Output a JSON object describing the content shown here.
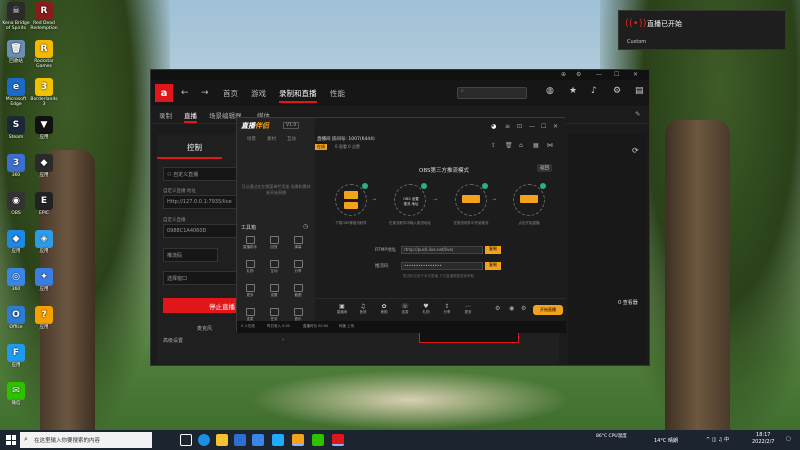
{
  "desktop": {
    "icons_col1": [
      {
        "label": "Kena Bridge of Spirits",
        "color": "#2b2b2b",
        "glyph": "☠"
      },
      {
        "label": "回收站",
        "color": "#6b8fb3",
        "glyph": "🗑"
      },
      {
        "label": "Microsoft Edge",
        "color": "#1b6ac9",
        "glyph": "e"
      },
      {
        "label": "Steam",
        "color": "#1b2838",
        "glyph": "S"
      },
      {
        "label": "360",
        "color": "#3b6fd0",
        "glyph": "3"
      },
      {
        "label": "OBS",
        "color": "#333",
        "glyph": "◉"
      },
      {
        "label": "应用",
        "color": "#1e88e5",
        "glyph": "◆"
      },
      {
        "label": "360",
        "color": "#3a86e8",
        "glyph": "◎"
      },
      {
        "label": "Office",
        "color": "#2c7cd6",
        "glyph": "O"
      },
      {
        "label": "应用",
        "color": "#1d9bf0",
        "glyph": "F"
      },
      {
        "label": "微信",
        "color": "#2dc100",
        "glyph": "✉"
      }
    ],
    "icons_col2": [
      {
        "label": "Red Dead Redemption",
        "color": "#8b1c1c",
        "glyph": "R"
      },
      {
        "label": "Rockstar Games",
        "color": "#f5b800",
        "glyph": "R"
      },
      {
        "label": "Borderlands 3",
        "color": "#f2c200",
        "glyph": "3"
      },
      {
        "label": "应用",
        "color": "#111",
        "glyph": "▼"
      },
      {
        "label": "应用",
        "color": "#2a2a2a",
        "glyph": "◆"
      },
      {
        "label": "EPIC",
        "color": "#222",
        "glyph": "E"
      },
      {
        "label": "应用",
        "color": "#2e9be8",
        "glyph": "◈"
      },
      {
        "label": "应用",
        "color": "#3b7de0",
        "glyph": "✦"
      },
      {
        "label": "应用",
        "color": "#f5a000",
        "glyph": "?"
      }
    ]
  },
  "notification": {
    "title": "直播已开始",
    "subtitle": "Custom"
  },
  "amd_window": {
    "logo": "a",
    "nav": {
      "items": [
        "首页",
        "游戏",
        "录制和直播",
        "性能"
      ],
      "active": "录制和直播"
    },
    "subtabs": [
      "录制",
      "直播",
      "场景编辑器",
      "媒体"
    ],
    "active_subtab": "直播",
    "left_panel": {
      "header": "控制",
      "platform": "自定义直播",
      "url_label": "自定义直播 地址",
      "url_value": "Http://127.0.0.1:7935/live",
      "key_label": "自定义直播",
      "key_value": "0988C1A4060D",
      "field3": "推流码",
      "field4": "选择窗口",
      "stop_label": "停止直播",
      "footer1": "麦克风",
      "footer2": "高级设置"
    },
    "preview_text": "WWAVU",
    "viewers": "0 查看器"
  },
  "overlay_app": {
    "brand_a": "直播",
    "brand_b": "伴侣",
    "version": "V1.0",
    "tabs": [
      "场景",
      "素材",
      "互动"
    ],
    "hint": "可以通过在左侧菜单栏添加 场景和素材来开始直播",
    "tools_label": "工具箱",
    "tool_labels": [
      "直播助手",
      "回放",
      "弹幕",
      "礼物",
      "互动",
      "分享",
      "更多",
      "设置",
      "截图",
      "连麦",
      "任务",
      "音乐"
    ],
    "room": "直播间 房间号: 1007(6444)",
    "room_tag": "在线",
    "room2": "0 观看  0 点赞",
    "mode_title": "OBS第三方推流模式",
    "back_label": "返回",
    "steps": [
      {
        "top": "",
        "bottom": "",
        "caption": "下载OBS等推流软件"
      },
      {
        "top": "OBS 设置",
        "bottom": "推流 地址",
        "caption": "在推流软件中输入推流地址"
      },
      {
        "top": "",
        "bottom": "",
        "caption": "在推流软件中开始推流"
      },
      {
        "top": "",
        "bottom": "",
        "caption": "点击开始直播"
      }
    ],
    "rows": [
      {
        "label": "RTMP地址",
        "value": "rtmp://push.live.net/live/",
        "btn": "复制"
      },
      {
        "label": "推流码",
        "value": "••••••••••••••••",
        "btn": "复制"
      }
    ],
    "tip": "推流码仅用于本次直播,下次直播需要重新获取",
    "bottom_buttons": [
      "直播间",
      "音效",
      "美颜",
      "连麦",
      "礼物",
      "分享",
      "更多"
    ],
    "live_label": "开始直播",
    "status": [
      "0 人在线",
      "昨日收入 0.00",
      "直播时长 00:00",
      "网速 上传"
    ]
  },
  "taskbar": {
    "search_placeholder": "在这里输入你要搜索的内容",
    "weather": "14°C  晴朗",
    "cpu": "86°C CPU温度",
    "time": "18:17",
    "date": "2022/2/7"
  }
}
